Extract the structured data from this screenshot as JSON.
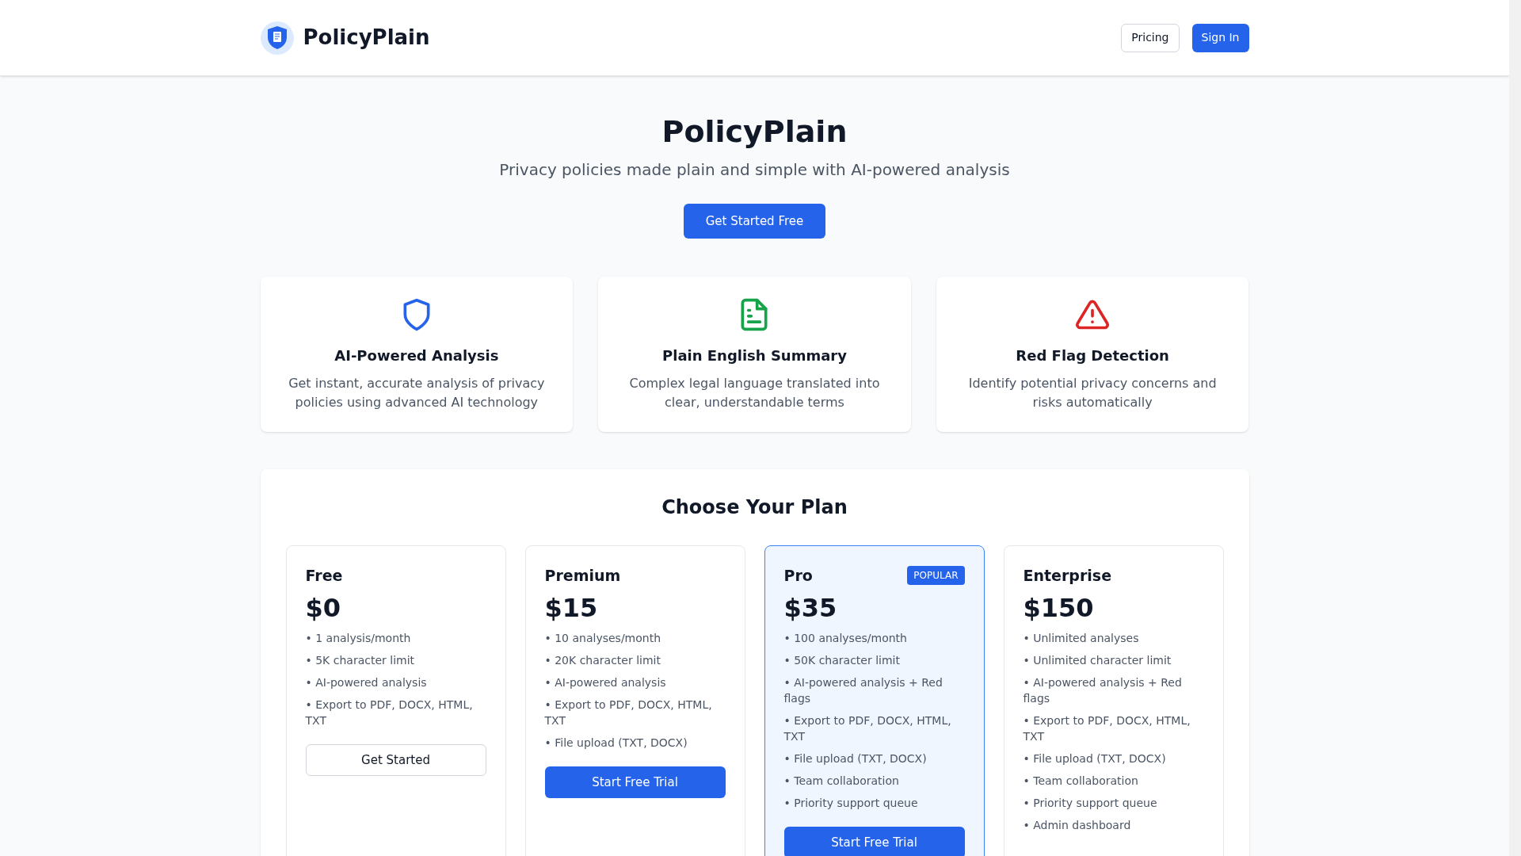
{
  "header": {
    "brand": "PolicyPlain",
    "nav": [
      {
        "label": "Pricing",
        "kind": "outline"
      },
      {
        "label": "Sign In",
        "kind": "primary"
      }
    ]
  },
  "hero": {
    "title": "PolicyPlain",
    "subtitle": "Privacy policies made plain and simple with AI-powered analysis",
    "cta": "Get Started Free"
  },
  "features": [
    {
      "kind": "shield",
      "title": "AI-Powered Analysis",
      "text": "Get instant, accurate analysis of privacy policies using advanced AI technology"
    },
    {
      "kind": "document",
      "title": "Plain English Summary",
      "text": "Complex legal language translated into clear, understandable terms"
    },
    {
      "kind": "warning",
      "title": "Red Flag Detection",
      "text": "Identify potential privacy concerns and risks automatically"
    }
  ],
  "pricing": {
    "title": "Choose Your Plan",
    "plans": [
      {
        "name": "Free",
        "price": "$0",
        "highlighted": false,
        "features": [
          "• 1 analysis/month",
          "• 5K character limit",
          "• AI-powered analysis",
          "• Export to PDF, DOCX, HTML, TXT"
        ],
        "button": {
          "label": "Get Started",
          "kind": "outline"
        }
      },
      {
        "name": "Premium",
        "price": "$15",
        "highlighted": false,
        "features": [
          "• 10 analyses/month",
          "• 20K character limit",
          "• AI-powered analysis",
          "• Export to PDF, DOCX, HTML, TXT",
          "• File upload (TXT, DOCX)"
        ],
        "button": {
          "label": "Start Free Trial",
          "kind": "primary"
        }
      },
      {
        "name": "Pro",
        "price": "$35",
        "highlighted": true,
        "badge": "POPULAR",
        "features": [
          "• 100 analyses/month",
          "• 50K character limit",
          "• AI-powered analysis + Red flags",
          "• Export to PDF, DOCX, HTML, TXT",
          "• File upload (TXT, DOCX)",
          "• Team collaboration",
          "• Priority support queue"
        ],
        "button": {
          "label": "Start Free Trial",
          "kind": "primary"
        }
      },
      {
        "name": "Enterprise",
        "price": "$150",
        "highlighted": false,
        "features": [
          "• Unlimited analyses",
          "• Unlimited character limit",
          "• AI-powered analysis + Red flags",
          "• Export to PDF, DOCX, HTML, TXT",
          "• File upload (TXT, DOCX)",
          "• Team collaboration",
          "• Priority support queue",
          "• Admin dashboard"
        ]
      }
    ]
  }
}
